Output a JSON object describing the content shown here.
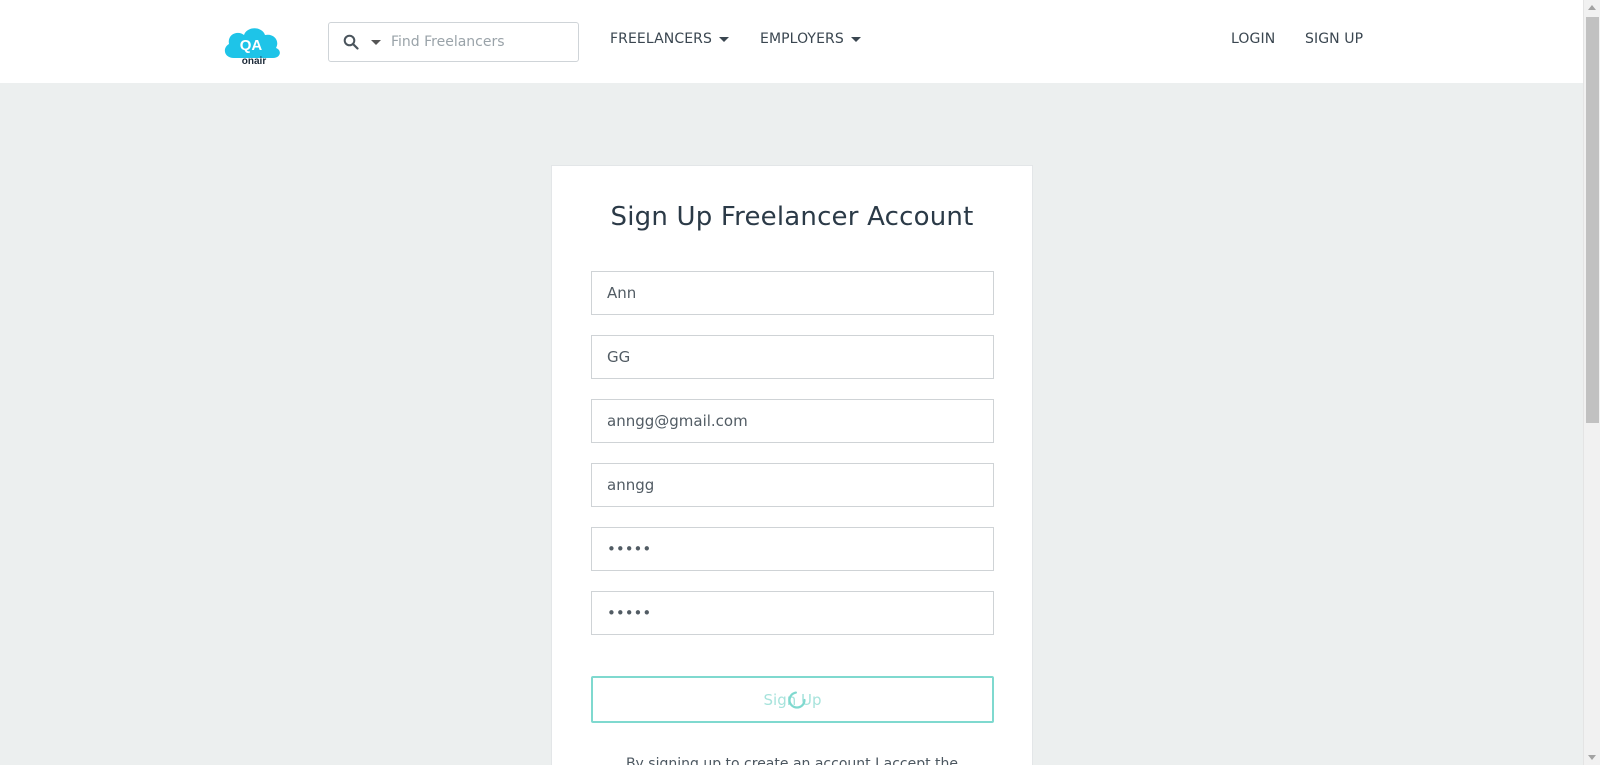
{
  "header": {
    "logo_text": "QA",
    "logo_subtext": "onair",
    "search": {
      "placeholder": "Find Freelancers"
    },
    "nav": {
      "freelancers": "FREELANCERS",
      "employers": "EMPLOYERS",
      "login": "LOGIN",
      "signup": "SIGN UP"
    }
  },
  "form": {
    "title": "Sign Up Freelancer Account",
    "fields": {
      "first_name": "Ann",
      "last_name": "GG",
      "email": "anngg@gmail.com",
      "username": "anngg",
      "password": "•••••",
      "confirm_password": "•••••"
    },
    "submit_label": "Sign Up",
    "terms_text": "By signing up to create an account I accept the"
  },
  "colors": {
    "accent": "#1ec4e8",
    "button_border": "#7fd9cf",
    "page_bg": "#ecefef"
  }
}
